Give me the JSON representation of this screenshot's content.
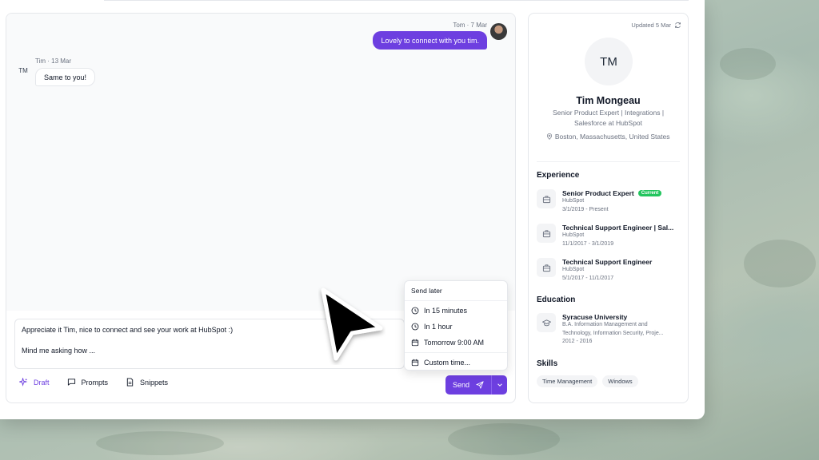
{
  "chat": {
    "outgoing": {
      "sender": "Tom",
      "date": "7 Mar",
      "text": "Lovely to connect with you tim."
    },
    "incoming": {
      "sender": "Tim",
      "date": "13 Mar",
      "initials": "TM",
      "text": "Same to you!"
    },
    "composer": {
      "line1": "Appreciate it Tim, nice to connect and see your work at HubSpot :)",
      "line2": "Mind me asking how ..."
    },
    "toolbar": {
      "draft": "Draft",
      "prompts": "Prompts",
      "snippets": "Snippets"
    },
    "send_label": "Send"
  },
  "send_later_menu": {
    "title": "Send later",
    "items": [
      {
        "label": "In 15 minutes",
        "icon": "clock-icon"
      },
      {
        "label": "In 1 hour",
        "icon": "clock-icon"
      },
      {
        "label": "Tomorrow 9:00 AM",
        "icon": "calendar-icon"
      },
      {
        "label": "Custom time...",
        "icon": "calendar-icon"
      }
    ]
  },
  "profile": {
    "updated": "Updated 5 Mar",
    "initials": "TM",
    "name": "Tim Mongeau",
    "headline_line1": "Senior Product Expert | Integrations |",
    "headline_line2": "Salesforce at HubSpot",
    "location": "Boston, Massachusetts, United States",
    "experience_heading": "Experience",
    "experience": [
      {
        "title": "Senior Product Expert",
        "company": "HubSpot",
        "dates": "3/1/2019 - Present",
        "badge": "Current"
      },
      {
        "title": "Technical Support Engineer | Sal...",
        "company": "HubSpot",
        "dates": "11/1/2017 - 3/1/2019"
      },
      {
        "title": "Technical Support Engineer",
        "company": "HubSpot",
        "dates": "5/1/2017 - 11/1/2017"
      }
    ],
    "education_heading": "Education",
    "education": [
      {
        "school": "Syracuse University",
        "degree_line1": "B.A. Information Management and",
        "degree_line2": "Technology, Information Security, Proje...",
        "dates": "2012 - 2016"
      }
    ],
    "skills_heading": "Skills",
    "skills": [
      "Time Management",
      "Windows"
    ]
  },
  "colors": {
    "accent": "#6d3fe0",
    "badge": "#22c55e"
  }
}
